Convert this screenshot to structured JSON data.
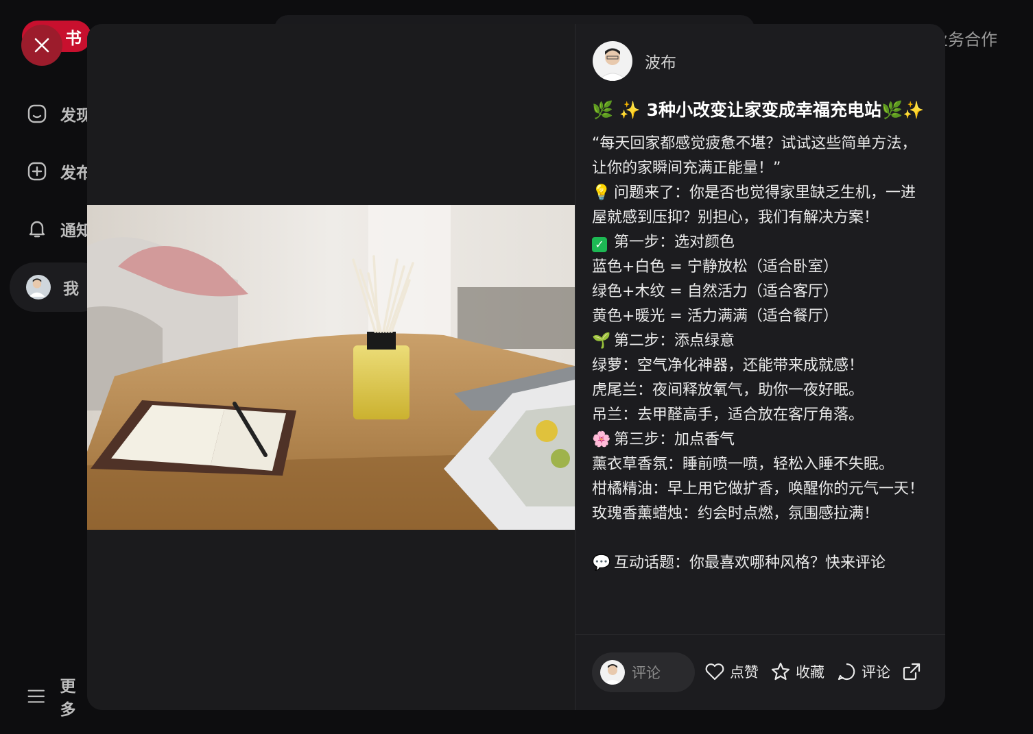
{
  "app": {
    "logo_text": "书",
    "biz_link": "业务合作"
  },
  "sidebar": {
    "items": [
      {
        "label": "发现",
        "icon": "home-icon"
      },
      {
        "label": "发布",
        "icon": "plus-circle-icon"
      },
      {
        "label": "通知",
        "icon": "bell-icon"
      },
      {
        "label": "我",
        "icon": "avatar"
      }
    ],
    "more_label": "更多"
  },
  "note": {
    "author": "波布",
    "title": "🌿 ✨ 3种小改变让家变成幸福充电站🌿✨",
    "lines": [
      {
        "emoji": "",
        "text": "“每天回家都感觉疲惫不堪？试试这些简单方法，让你的家瞬间充满正能量！”"
      },
      {
        "emoji": "💡",
        "text": "问题来了：你是否也觉得家里缺乏生机，一进屋就感到压抑？别担心，我们有解决方案！"
      },
      {
        "emoji": "✅",
        "text": "第一步：选对颜色"
      },
      {
        "emoji": "",
        "text": "蓝色+白色 = 宁静放松（适合卧室）"
      },
      {
        "emoji": "",
        "text": "绿色+木纹 = 自然活力（适合客厅）"
      },
      {
        "emoji": "",
        "text": "黄色+暖光 = 活力满满（适合餐厅）"
      },
      {
        "emoji": "🌱",
        "text": "第二步：添点绿意"
      },
      {
        "emoji": "",
        "text": "绿萝：空气净化神器，还能带来成就感！"
      },
      {
        "emoji": "",
        "text": "虎尾兰：夜间释放氧气，助你一夜好眠。"
      },
      {
        "emoji": "",
        "text": "吊兰：去甲醛高手，适合放在客厅角落。"
      },
      {
        "emoji": "🌸",
        "text": "第三步：加点香气"
      },
      {
        "emoji": "",
        "text": "薰衣草香氛：睡前喷一喷，轻松入睡不失眠。"
      },
      {
        "emoji": "",
        "text": "柑橘精油：早上用它做扩香，唤醒你的元气一天！"
      },
      {
        "emoji": "",
        "text": "玫瑰香薰蜡烛：约会时点燃，氛围感拉满！"
      },
      {
        "emoji": "",
        "text": " "
      },
      {
        "emoji": "💬",
        "text": "互动话题：你最喜欢哪种风格？快来评论"
      }
    ]
  },
  "bottom": {
    "comment_placeholder": "评论",
    "like_label": "点赞",
    "collect_label": "收藏",
    "comment_label": "评论"
  }
}
